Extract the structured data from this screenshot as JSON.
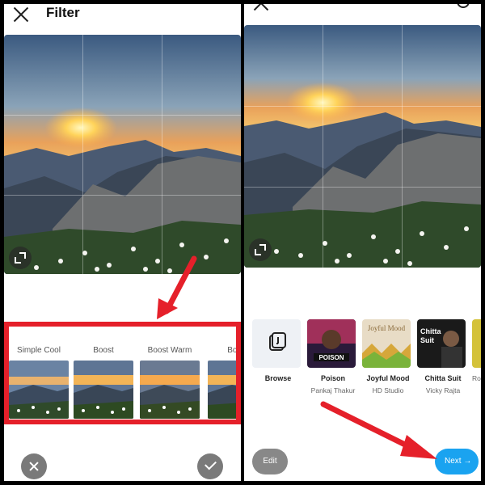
{
  "left": {
    "title": "Filter",
    "filters": [
      {
        "label": "Simple Cool"
      },
      {
        "label": "Boost"
      },
      {
        "label": "Boost Warm"
      },
      {
        "label": "Boost"
      }
    ]
  },
  "right": {
    "tracks": [
      {
        "name": "Browse",
        "artist": ""
      },
      {
        "name": "Poison",
        "artist": "Pankaj Thakur",
        "art_text": "POISON"
      },
      {
        "name": "Joyful Mood",
        "artist": "HD Studio",
        "art_text": "Joyful Mood"
      },
      {
        "name": "Chitta Suit",
        "artist": "Vicky Rajta",
        "art_text": "Chitta Suit"
      },
      {
        "name": "",
        "artist": "Ro"
      }
    ],
    "edit_label": "Edit",
    "next_label": "Next →"
  },
  "colors": {
    "annotation_red": "#e5202a",
    "next_blue": "#1aa3f0"
  }
}
